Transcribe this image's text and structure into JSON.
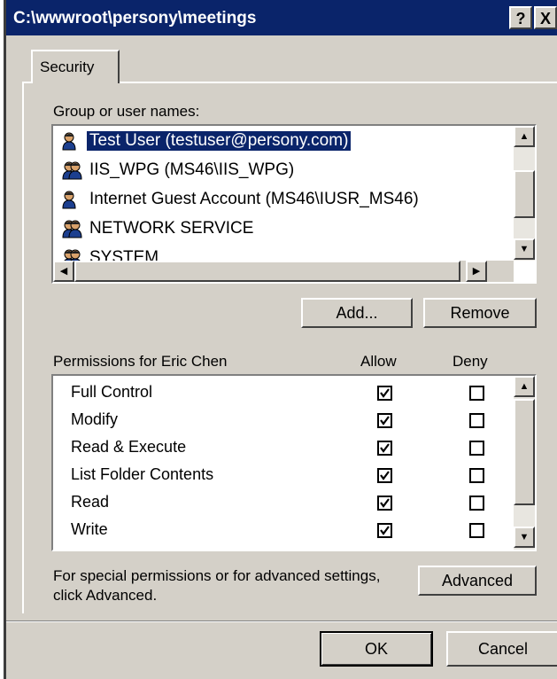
{
  "window": {
    "title": "C:\\wwwroot\\persony\\meetings"
  },
  "titlebar": {
    "help_label": "?",
    "close_label": "X"
  },
  "tabs": [
    {
      "label": "Security"
    }
  ],
  "group_section": {
    "label": "Group or user names:",
    "users": [
      {
        "name": "Test User (testuser@persony.com)",
        "icon": "user-icon",
        "selected": true
      },
      {
        "name": "IIS_WPG (MS46\\IIS_WPG)",
        "icon": "group-icon",
        "selected": false
      },
      {
        "name": "Internet Guest Account (MS46\\IUSR_MS46)",
        "icon": "user-icon",
        "selected": false
      },
      {
        "name": "NETWORK SERVICE",
        "icon": "group-icon",
        "selected": false
      },
      {
        "name": "SYSTEM",
        "icon": "group-icon",
        "selected": false
      }
    ]
  },
  "buttons": {
    "add": "Add...",
    "remove": "Remove",
    "advanced": "Advanced",
    "ok": "OK",
    "cancel": "Cancel"
  },
  "permissions": {
    "label": "Permissions for Eric Chen",
    "allow_header": "Allow",
    "deny_header": "Deny",
    "items": [
      {
        "name": "Full Control",
        "allow": true,
        "deny": false
      },
      {
        "name": "Modify",
        "allow": true,
        "deny": false
      },
      {
        "name": "Read & Execute",
        "allow": true,
        "deny": false
      },
      {
        "name": "List Folder Contents",
        "allow": true,
        "deny": false
      },
      {
        "name": "Read",
        "allow": true,
        "deny": false
      },
      {
        "name": "Write",
        "allow": true,
        "deny": false
      }
    ]
  },
  "advanced_note": {
    "line1": "For special permissions or for advanced settings,",
    "line2": "click Advanced."
  },
  "colors": {
    "titlebar": "#0a246a",
    "dialog": "#d4d0c8",
    "selection": "#0a246a"
  }
}
